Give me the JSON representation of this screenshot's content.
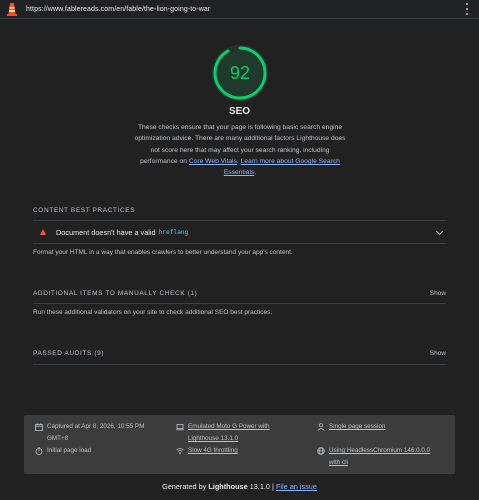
{
  "browser": {
    "url": "https://www.fablereads.com/en/fable/the-lion-going-to-war"
  },
  "score": {
    "value": "92",
    "fraction": 0.92,
    "color": "#0cce6b",
    "title": "SEO"
  },
  "description": {
    "text_1": "These checks ensure that your page is following basic search engine optimization advice. There are many additional factors Lighthouse does not score here that may affect your search ranking, including performance on",
    "link_1": "Core Web Vitals",
    "text_2": ".",
    "link_2": "Learn more about Google Search Essentials",
    "text_3": "."
  },
  "content_best_practices": {
    "heading": "CONTENT BEST PRACTICES",
    "audit_title": "Document doesn't have a valid",
    "audit_code": "hreflang",
    "audit_status": "fail",
    "description": "Format your HTML in a way that enables crawlers to better understand your app's content."
  },
  "manual_checks": {
    "heading": "ADDITIONAL ITEMS TO MANUALLY CHECK (1)",
    "show_label": "Show",
    "description": "Run these additional validators on your site to check additional SEO best practices."
  },
  "passed_audits": {
    "heading": "PASSED AUDITS (9)",
    "show_label": "Show"
  },
  "footer": {
    "captured_line1": "Captured at Apr 8, 2026, 10:55 PM",
    "captured_line2": "GMT+8",
    "initial_load": "Initial page load",
    "device_line1": "Emulated Moto G Power with",
    "device_line2": "Lighthouse 13.1.0",
    "throttling": "Slow 4G throttling",
    "session": "Single page session",
    "browser_line1": "Using HeadlessChromium 146.0.0.0",
    "browser_line2": "with cli"
  },
  "generated": {
    "prefix": "Generated by",
    "product": "Lighthouse",
    "version": "13.1.0 |",
    "issue_link": "File an issue"
  }
}
